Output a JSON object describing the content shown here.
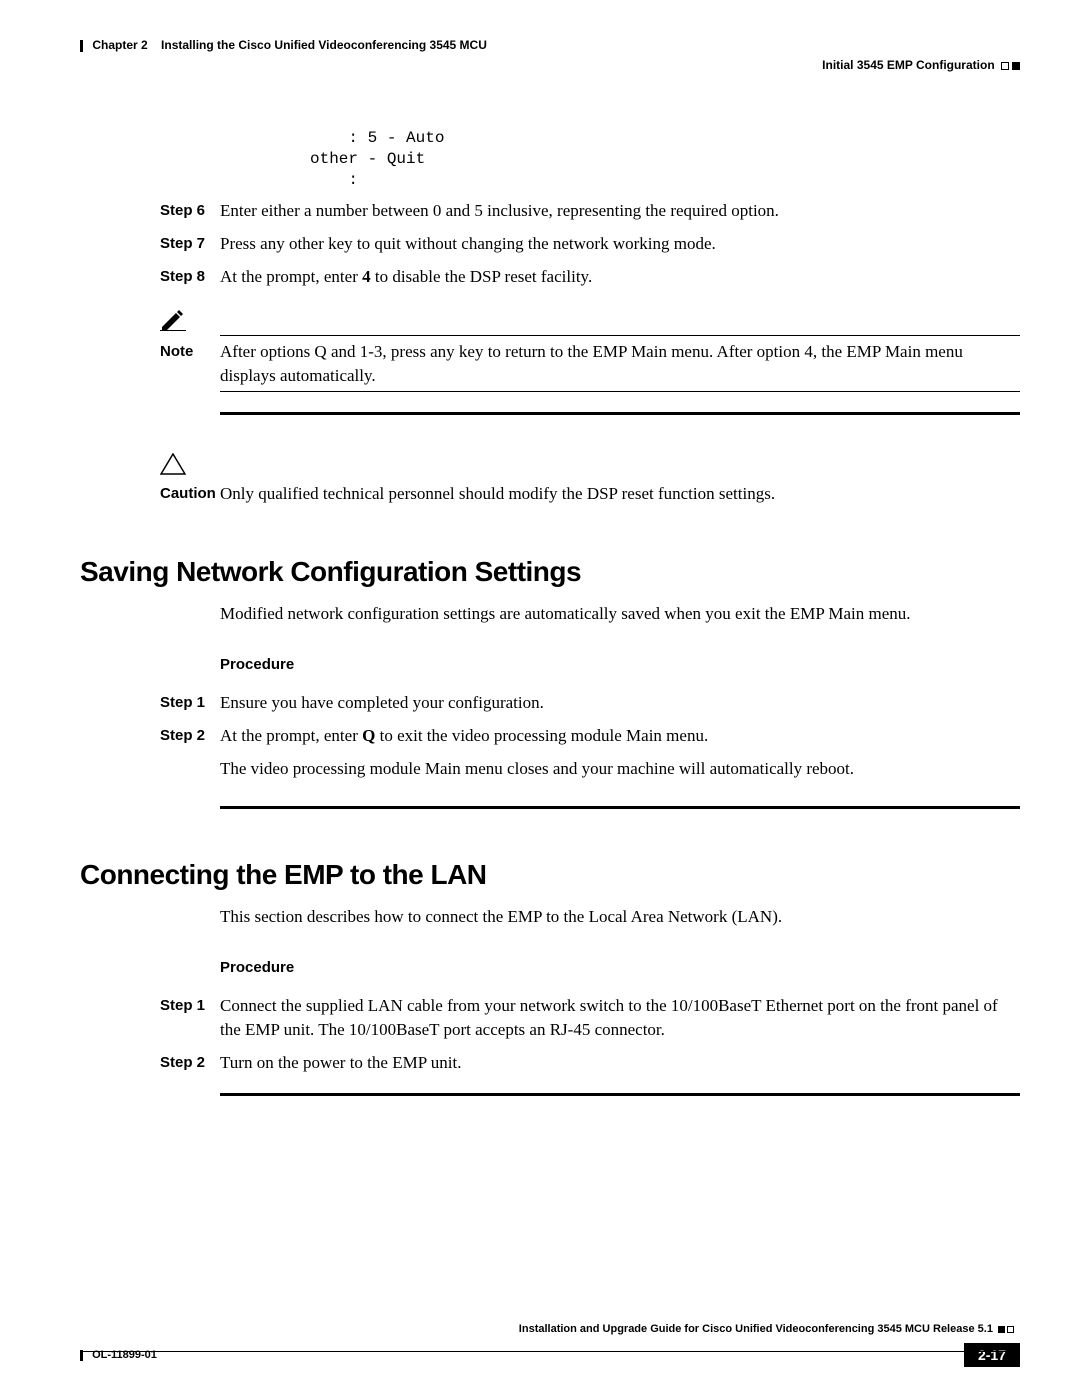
{
  "header": {
    "chapter_label": "Chapter 2",
    "chapter_title": "Installing the Cisco Unified Videoconferencing 3545 MCU",
    "section_right": "Initial 3545 EMP Configuration"
  },
  "code_block": "    : 5 - Auto\nother - Quit\n    :",
  "steps_a": [
    {
      "label": "Step 6",
      "text": "Enter either a number between 0 and 5 inclusive, representing the required option."
    },
    {
      "label": "Step 7",
      "text": "Press any other key to quit without changing the network working mode."
    },
    {
      "label": "Step 8",
      "text_pre": "At the prompt, enter ",
      "bold": "4",
      "text_post": " to disable the DSP reset facility."
    }
  ],
  "note": {
    "label": "Note",
    "text": "After options Q and 1-3, press any key to return to the EMP Main menu. After option 4, the EMP Main menu displays automatically."
  },
  "caution": {
    "label": "Caution",
    "text": "Only qualified technical personnel should modify the DSP reset function settings."
  },
  "section1": {
    "title": "Saving Network Configuration Settings",
    "intro": "Modified network configuration settings are automatically saved when you exit the EMP Main menu.",
    "proc_label": "Procedure",
    "steps": [
      {
        "label": "Step 1",
        "text": "Ensure you have completed your configuration."
      },
      {
        "label": "Step 2",
        "text_pre": "At the prompt, enter ",
        "bold": "Q",
        "text_post": " to exit the video processing module Main menu."
      }
    ],
    "after": "The video processing module Main menu closes and your machine will automatically reboot."
  },
  "section2": {
    "title": "Connecting the EMP to the LAN",
    "intro": "This section describes how to connect the EMP to the Local Area Network (LAN).",
    "proc_label": "Procedure",
    "steps": [
      {
        "label": "Step 1",
        "text": "Connect the supplied LAN cable from your network switch to the 10/100BaseT Ethernet port on the front panel of the EMP unit. The 10/100BaseT port accepts an RJ-45 connector."
      },
      {
        "label": "Step 2",
        "text": "Turn on the power to the EMP unit."
      }
    ]
  },
  "footer": {
    "doc_title": "Installation and Upgrade Guide for Cisco Unified Videoconferencing 3545 MCU Release 5.1",
    "doc_id": "OL-11899-01",
    "page_num": "2-17"
  }
}
